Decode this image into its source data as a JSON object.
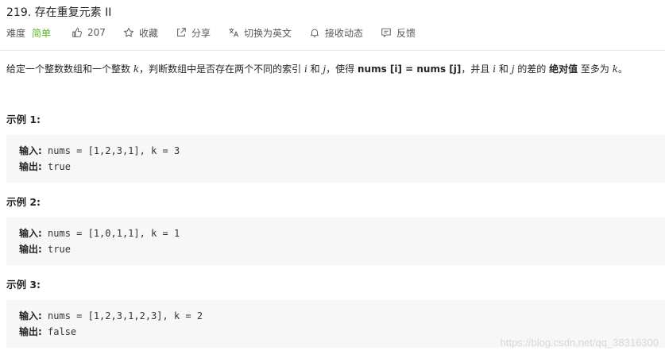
{
  "problem": {
    "title": "219. 存在重复元素 II"
  },
  "meta": {
    "difficulty_label": "难度",
    "difficulty": "简单",
    "likes": "207",
    "favorite": "收藏",
    "share": "分享",
    "switch_lang": "切换为英文",
    "notify": "接收动态",
    "feedback": "反馈",
    "difficulty_color": "#5ab726"
  },
  "description": {
    "p1": "给定一个整数数组和一个整数 ",
    "k": "k",
    "p2": "，判断数组中是否存在两个不同的索引 ",
    "i": "i",
    "and1": " 和 ",
    "j": "j",
    "p3": "，使得 ",
    "b1": "nums [i] = nums [j]",
    "p4": "，并且 ",
    "i2": "i",
    "and2": " 和 ",
    "j2": "j",
    "p5": " 的差的 ",
    "b2": "绝对值",
    "p6": " 至多为 ",
    "k2": "k",
    "p7": "。"
  },
  "examples": [
    {
      "title": "示例 1:",
      "input_label": "输入:",
      "input": " nums = [1,2,3,1], k = 3",
      "output_label": "输出:",
      "output": " true"
    },
    {
      "title": "示例 2:",
      "input_label": "输入:",
      "input": " nums = [1,0,1,1], k = 1",
      "output_label": "输出:",
      "output": " true"
    },
    {
      "title": "示例 3:",
      "input_label": "输入:",
      "input": " nums = [1,2,3,1,2,3], k = 2",
      "output_label": "输出:",
      "output": " false"
    }
  ],
  "watermark": "https://blog.csdn.net/qq_38316300"
}
